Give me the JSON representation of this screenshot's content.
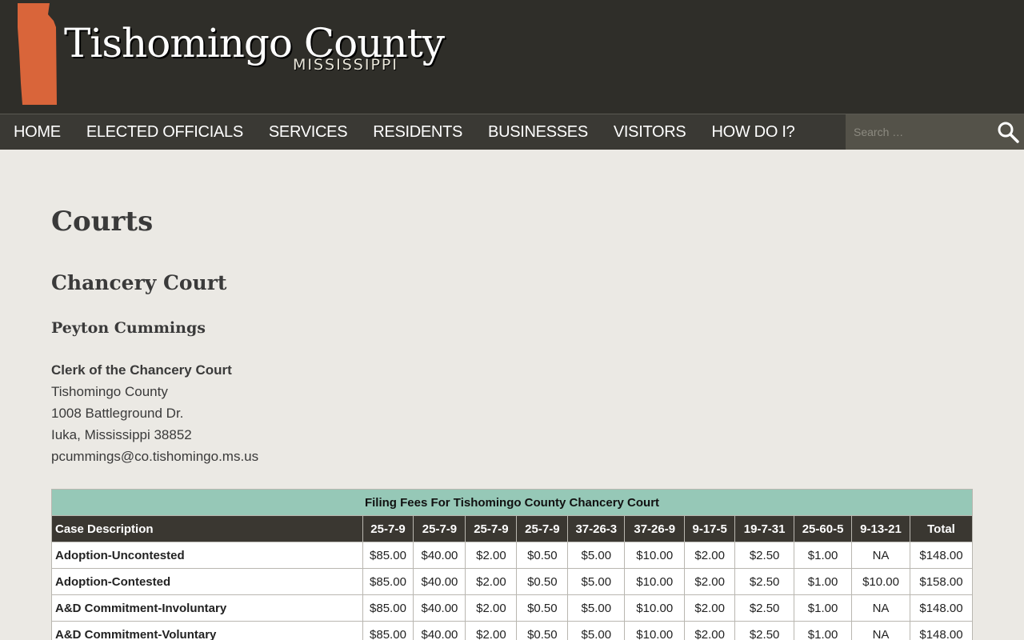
{
  "header": {
    "title": "Tishomingo County",
    "subtitle": "MISSISSIPPI",
    "logo_color": "#d9653a"
  },
  "nav": {
    "items": [
      {
        "label": "HOME"
      },
      {
        "label": "ELECTED OFFICIALS"
      },
      {
        "label": "SERVICES"
      },
      {
        "label": "RESIDENTS"
      },
      {
        "label": "BUSINESSES"
      },
      {
        "label": "VISITORS"
      },
      {
        "label": "HOW DO I?"
      }
    ],
    "search": {
      "placeholder": "Search …",
      "icon": "search-icon"
    }
  },
  "page": {
    "title": "Courts",
    "section_title": "Chancery Court",
    "person_name": "Peyton Cummings",
    "role": "Clerk of the Chancery Court",
    "address_lines": [
      "Tishomingo County",
      "1008 Battleground Dr.",
      "Iuka, Mississippi 38852"
    ],
    "email": "pcummings@co.tishomingo.ms.us"
  },
  "fees_table": {
    "caption": "Filing Fees For Tishomingo County Chancery Court",
    "columns": [
      "Case Description",
      "25-7-9",
      "25-7-9",
      "25-7-9",
      "25-7-9",
      "37-26-3",
      "37-26-9",
      "9-17-5",
      "19-7-31",
      "25-60-5",
      "9-13-21",
      "Total"
    ],
    "rows": [
      [
        "Adoption-Uncontested",
        "$85.00",
        "$40.00",
        "$2.00",
        "$0.50",
        "$5.00",
        "$10.00",
        "$2.00",
        "$2.50",
        "$1.00",
        "NA",
        "$148.00"
      ],
      [
        "Adoption-Contested",
        "$85.00",
        "$40.00",
        "$2.00",
        "$0.50",
        "$5.00",
        "$10.00",
        "$2.00",
        "$2.50",
        "$1.00",
        "$10.00",
        "$158.00"
      ],
      [
        "A&D Commitment-Involuntary",
        "$85.00",
        "$40.00",
        "$2.00",
        "$0.50",
        "$5.00",
        "$10.00",
        "$2.00",
        "$2.50",
        "$1.00",
        "NA",
        "$148.00"
      ],
      [
        "A&D Commitment-Voluntary",
        "$85.00",
        "$40.00",
        "$2.00",
        "$0.50",
        "$5.00",
        "$10.00",
        "$2.00",
        "$2.50",
        "$1.00",
        "NA",
        "$148.00"
      ]
    ]
  }
}
